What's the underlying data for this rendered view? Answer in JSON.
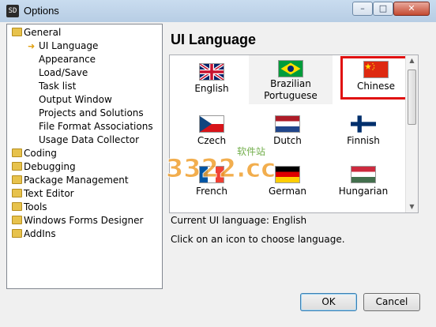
{
  "window": {
    "title": "Options",
    "icon_text": "SD",
    "minimize": "–",
    "maximize": "□",
    "close": "✕"
  },
  "tree": {
    "items": [
      {
        "label": "General",
        "level": 0,
        "kind": "folder"
      },
      {
        "label": "UI Language",
        "level": 1,
        "kind": "selected"
      },
      {
        "label": "Appearance",
        "level": 1,
        "kind": "leaf"
      },
      {
        "label": "Load/Save",
        "level": 1,
        "kind": "leaf"
      },
      {
        "label": "Task list",
        "level": 1,
        "kind": "leaf"
      },
      {
        "label": "Output Window",
        "level": 1,
        "kind": "leaf"
      },
      {
        "label": "Projects and Solutions",
        "level": 1,
        "kind": "leaf"
      },
      {
        "label": "File Format Associations",
        "level": 1,
        "kind": "leaf"
      },
      {
        "label": "Usage Data Collector",
        "level": 1,
        "kind": "leaf"
      },
      {
        "label": "Coding",
        "level": 0,
        "kind": "folder"
      },
      {
        "label": "Debugging",
        "level": 0,
        "kind": "folder"
      },
      {
        "label": "Package Management",
        "level": 0,
        "kind": "folder"
      },
      {
        "label": "Text Editor",
        "level": 0,
        "kind": "folder"
      },
      {
        "label": "Tools",
        "level": 0,
        "kind": "folder"
      },
      {
        "label": "Windows Forms Designer",
        "level": 0,
        "kind": "folder"
      },
      {
        "label": "AddIns",
        "level": 0,
        "kind": "folder"
      }
    ]
  },
  "panel": {
    "heading": "UI Language",
    "languages": [
      {
        "name": "English",
        "flag": "uk-flag-icon",
        "selected": false
      },
      {
        "name": "Brazilian Portuguese",
        "flag": "brazil-flag-icon",
        "selected": false
      },
      {
        "name": "Chinese",
        "flag": "china-flag-icon",
        "selected": true
      },
      {
        "name": "Czech",
        "flag": "czech-flag-icon",
        "selected": false
      },
      {
        "name": "Dutch",
        "flag": "netherlands-flag-icon",
        "selected": false
      },
      {
        "name": "Finnish",
        "flag": "finland-flag-icon",
        "selected": false
      },
      {
        "name": "French",
        "flag": "france-flag-icon",
        "selected": false
      },
      {
        "name": "German",
        "flag": "germany-flag-icon",
        "selected": false
      },
      {
        "name": "Hungarian",
        "flag": "hungary-flag-icon",
        "selected": false
      }
    ],
    "current_language_text": "Current UI language: English",
    "hint_text": "Click on an icon to choose language."
  },
  "buttons": {
    "ok": "OK",
    "cancel": "Cancel"
  },
  "watermark": {
    "text_large": "3322.cc",
    "text_small": "软件站"
  },
  "colors": {
    "selection_border": "#e01010",
    "title_bar": "#c4d7ea",
    "close_button": "#c44a31"
  }
}
